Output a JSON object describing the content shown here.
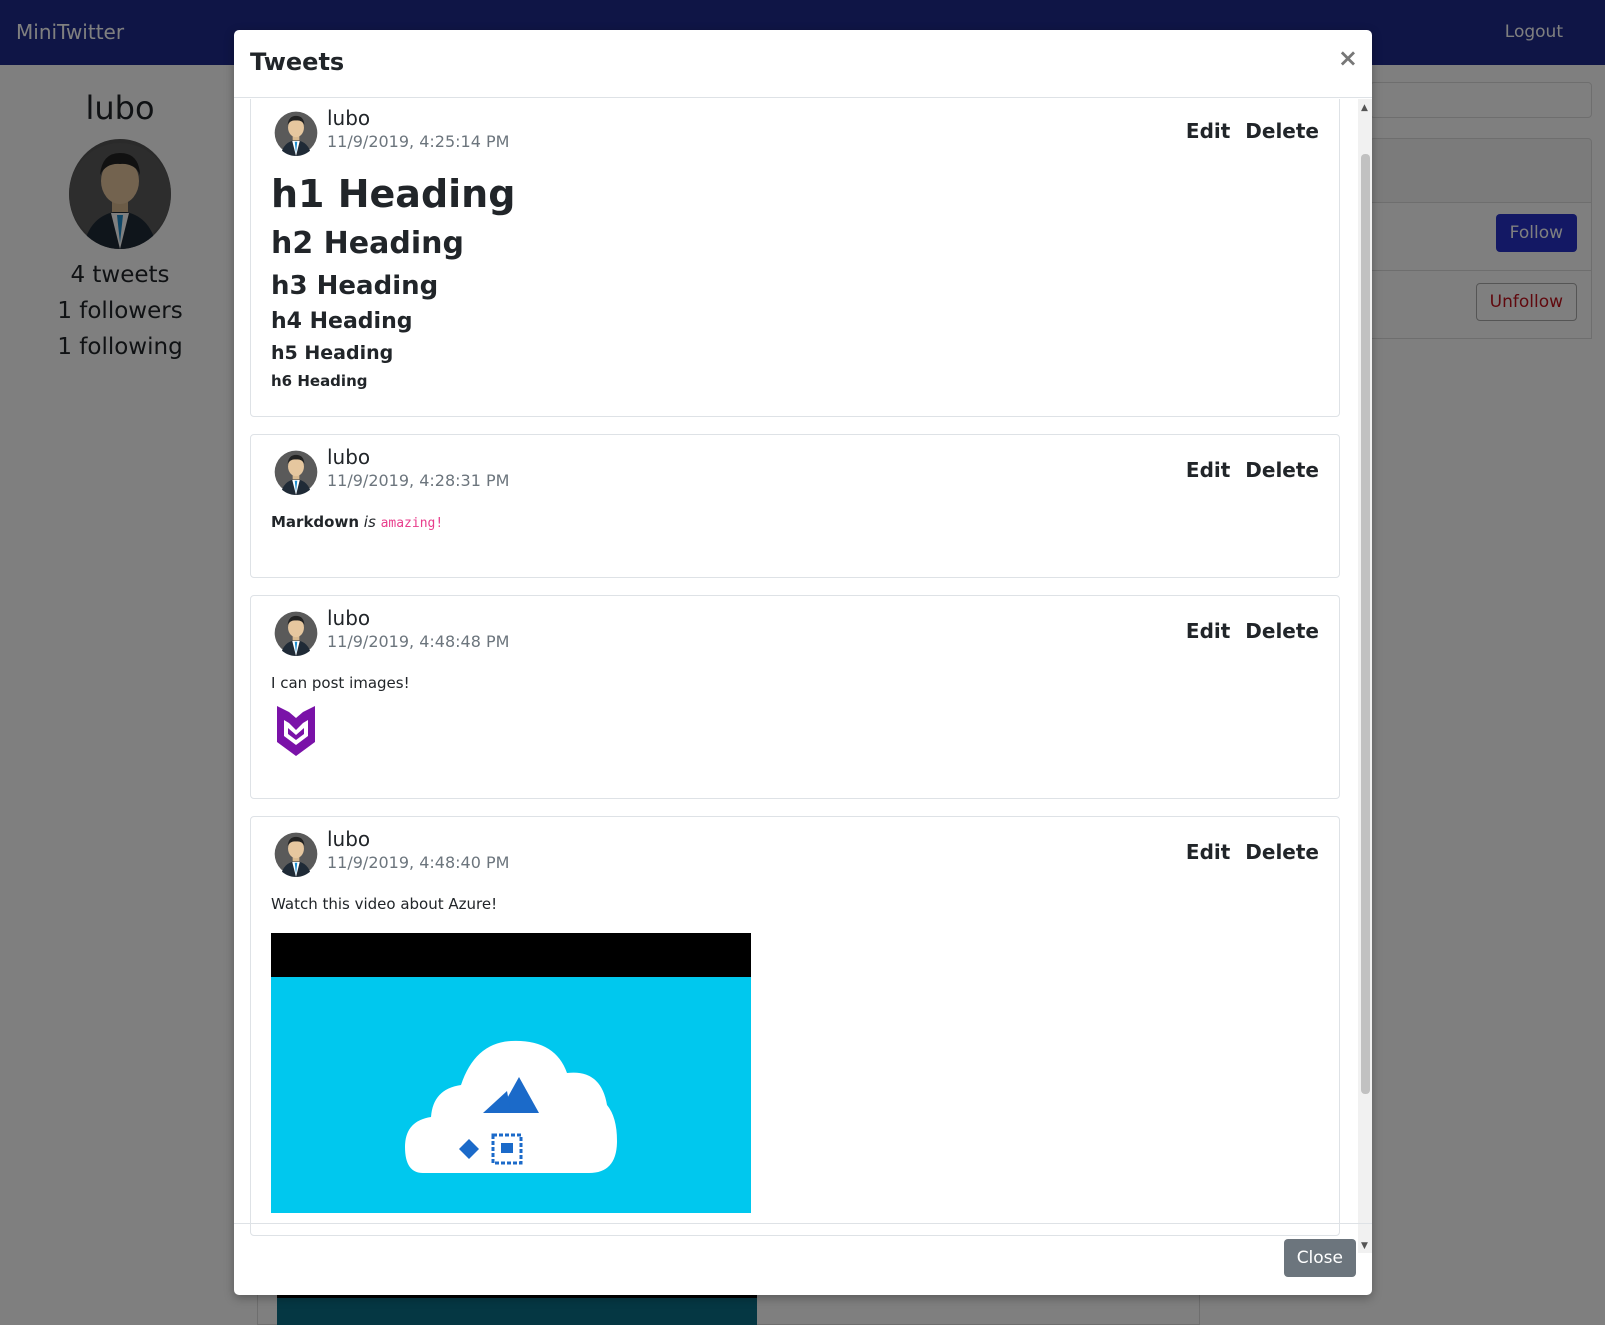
{
  "navbar": {
    "brand": "MiniTwitter",
    "logout": "Logout"
  },
  "profile": {
    "name": "lubo",
    "tweets": "4 tweets",
    "followers": "1 followers",
    "following": "1 following"
  },
  "right_panel": {
    "follow_label": "Follow",
    "unfollow_label": "Unfollow"
  },
  "modal": {
    "title": "Tweets",
    "close_x": "×",
    "close_label": "Close"
  },
  "tweets": [
    {
      "user": "lubo",
      "date": "11/9/2019, 4:25:14 PM",
      "edit": "Edit",
      "delete": "Delete",
      "headings": {
        "h1": "h1 Heading",
        "h2": "h2 Heading",
        "h3": "h3 Heading",
        "h4": "h4 Heading",
        "h5": "h5 Heading",
        "h6": "h6 Heading"
      }
    },
    {
      "user": "lubo",
      "date": "11/9/2019, 4:28:31 PM",
      "edit": "Edit",
      "delete": "Delete",
      "bold": "Markdown",
      "italic": "is",
      "code": "amazing!"
    },
    {
      "user": "lubo",
      "date": "11/9/2019, 4:48:48 PM",
      "edit": "Edit",
      "delete": "Delete",
      "text": "I can post images!",
      "image": "mcafee-shield-icon"
    },
    {
      "user": "lubo",
      "date": "11/9/2019, 4:48:40 PM",
      "edit": "Edit",
      "delete": "Delete",
      "text": "Watch this video about Azure!",
      "video": "azure-video-thumbnail"
    }
  ],
  "colors": {
    "navbar": "#1e2a8c",
    "follow": "#2631c9",
    "unfollow": "#c0121c",
    "code": "#e83e8c",
    "video_bg": "#00c8ee",
    "mcafee_purple": "#7a12a8",
    "azure_blue": "#1b6ac9"
  }
}
